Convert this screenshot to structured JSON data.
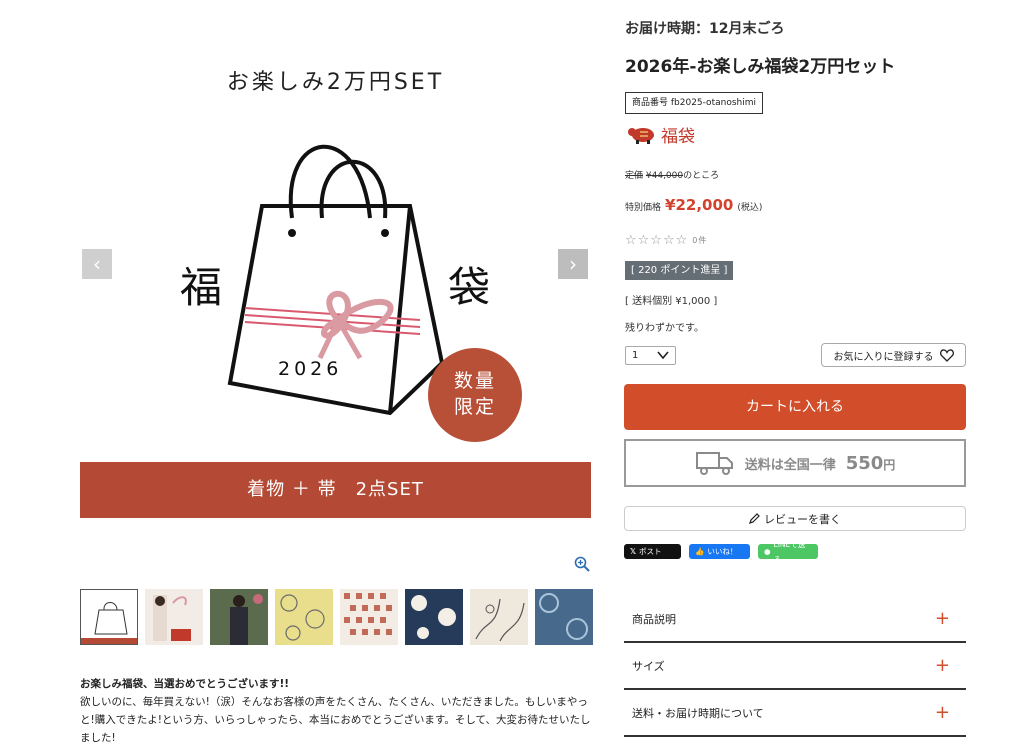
{
  "gallery": {
    "set_title": "お楽しみ2万円SET",
    "kanji_left": "福",
    "kanji_right": "袋",
    "bag_year": "2026",
    "limited_line1": "数量",
    "limited_line2": "限定",
    "banner_text": "着物 ＋ 帯　2点SET",
    "prev_arrow": "‹",
    "next_arrow": "›"
  },
  "description": {
    "title": "お楽しみ福袋、当選おめでとうございます!!",
    "body": "欲しいのに、毎年買えない!（涙）そんなお客様の声をたくさん、たくさん、いただきました。もしいまやっと!購入できたよ!という方、いらっしゃったら、本当におめでとうございます。そして、大変お待たせいたしました!"
  },
  "product": {
    "delivery": "お届け時期：12月末ごろ",
    "title": "2026年-お楽しみ福袋2万円セット",
    "sku": "商品番号 fb2025-otanoshimi",
    "tag_label": "福袋",
    "orig_label": "定価",
    "orig_price": "¥44,000",
    "orig_suffix": "のところ",
    "special_label": "特別価格",
    "price": "¥22,000",
    "tax": "(税込)",
    "stars": "☆☆☆☆☆",
    "review_count": "0件",
    "points": "[ 220 ポイント進呈 ]",
    "shipping_fee": "[ 送料個別 ¥1,000 ]",
    "stock_note": "残りわずかです。",
    "qty": "1",
    "favorite_label": "お気に入りに登録する",
    "cart_label": "カートに入れる",
    "ship_text": "送料は全国一律",
    "ship_amount": "550",
    "ship_unit": "円",
    "review_label": "レビューを書く"
  },
  "social": {
    "post": "ポスト",
    "like": "いいね！",
    "line": "LINEで送る"
  },
  "accordion": [
    {
      "label": "商品説明",
      "icon": "+"
    },
    {
      "label": "サイズ",
      "icon": "+"
    },
    {
      "label": "送料・お届け時期について",
      "icon": "+"
    }
  ],
  "colors": {
    "accent": "#d24e2a",
    "banner": "#b44a35",
    "price": "#d4412c"
  }
}
